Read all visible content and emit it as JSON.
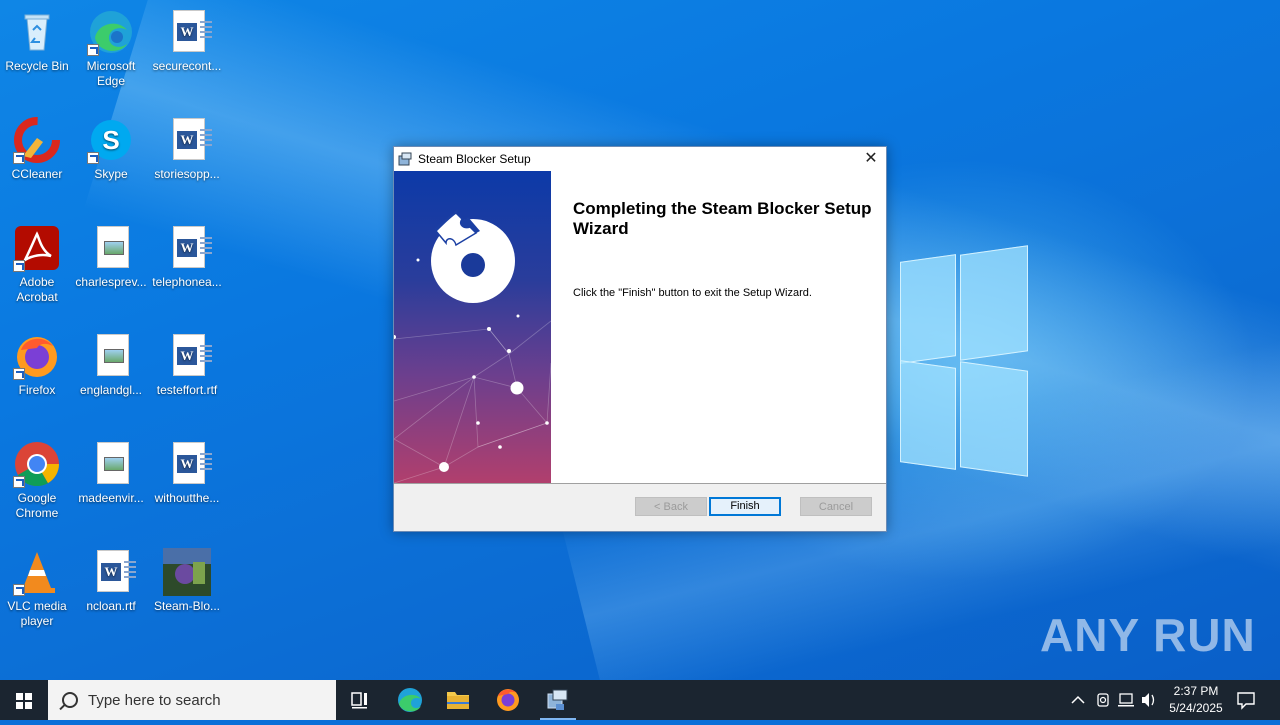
{
  "desktop": {
    "icons": [
      {
        "label": "Recycle Bin"
      },
      {
        "label": "Microsoft\nEdge"
      },
      {
        "label": "securecont..."
      },
      {
        "label": "CCleaner"
      },
      {
        "label": "Skype"
      },
      {
        "label": "storiesopp..."
      },
      {
        "label": "Adobe\nAcrobat"
      },
      {
        "label": "charlesprev..."
      },
      {
        "label": "telephonea..."
      },
      {
        "label": "Firefox"
      },
      {
        "label": "englandgl..."
      },
      {
        "label": "testeffort.rtf"
      },
      {
        "label": "Google\nChrome"
      },
      {
        "label": "madeenvir..."
      },
      {
        "label": "withoutthe..."
      },
      {
        "label": "VLC media\nplayer"
      },
      {
        "label": "ncloan.rtf"
      },
      {
        "label": "Steam-Blo..."
      }
    ]
  },
  "dialog": {
    "title": "Steam Blocker Setup",
    "close_symbol": "✕",
    "heading": "Completing the Steam Blocker Setup Wizard",
    "body": "Click the \"Finish\" button to exit the Setup Wizard.",
    "buttons": {
      "back": "< Back",
      "finish": "Finish",
      "cancel": "Cancel"
    }
  },
  "watermark": "ANY RUN",
  "taskbar": {
    "search_placeholder": "Type here to search",
    "time": "2:37 PM",
    "date": "5/24/2025"
  },
  "colors": {
    "taskbar": "#1b2530",
    "accent": "#0078d7",
    "word_blue": "#2b579a"
  }
}
